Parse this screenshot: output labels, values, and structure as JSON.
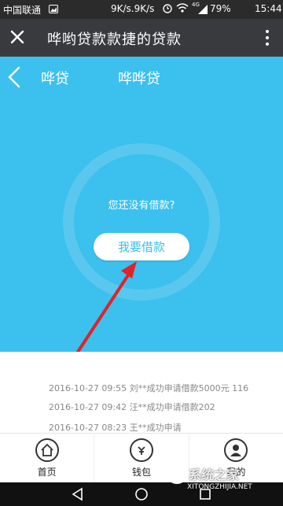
{
  "status_bar": {
    "carrier": "中国联通",
    "speed": "9K/s.9K/s",
    "network": "4G",
    "battery": "79%",
    "time": "15:44"
  },
  "title_bar": {
    "title": "哗哟贷款款捷的贷款"
  },
  "header_tabs": [
    "哗贷",
    "哗哗贷"
  ],
  "loan_status": {
    "empty_message": "您还没有借款?",
    "borrow_button": "我要借款"
  },
  "feed": [
    "2016-10-27 09:55 刘**成功申请借款5000元 116",
    "2016-10-27 09:42 汪**成功申请借款202",
    "2016-10-27 08:23 王**成功申请"
  ],
  "bottom_nav": [
    {
      "label": "首页",
      "icon": "home-icon"
    },
    {
      "label": "钱包",
      "icon": "yen-bag-icon"
    },
    {
      "label": "我的",
      "icon": "user-icon"
    }
  ],
  "watermark": {
    "text": "系统之家",
    "url": "XITONGZHIJIA.NET"
  },
  "colors": {
    "hero_bg": "#3cc0ee",
    "titlebar_bg": "#393a3e",
    "statusbar_bg": "#2b2b2b",
    "arrow": "#e0222a"
  }
}
